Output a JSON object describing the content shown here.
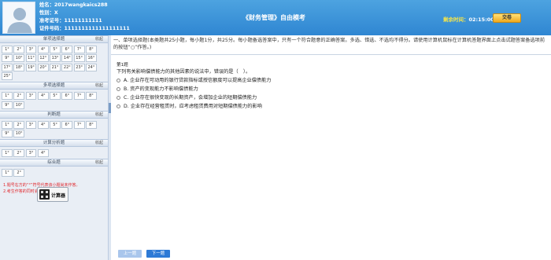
{
  "header": {
    "name": "姓名：2017wangkaics288",
    "gender": "性别：X",
    "admission": "准考证号：11111111111",
    "id_number": "证件号码：1111111111111111111",
    "title": "《财务管理》自由模考",
    "timer_label": "剩余时间：",
    "timer_value": "02:15:00",
    "submit_label": "交卷"
  },
  "sidebar": {
    "sections": [
      {
        "title": "单项选择题",
        "collapse": "收起",
        "items": [
          "1°",
          "2°",
          "3°",
          "4°",
          "5°",
          "6°",
          "7°",
          "8°",
          "9°",
          "10°",
          "11°",
          "12°",
          "13°",
          "14°",
          "15°",
          "16°",
          "17°",
          "18°",
          "19°",
          "20°",
          "21°",
          "22°",
          "23°",
          "24°",
          "25°"
        ]
      },
      {
        "title": "多项选择题",
        "collapse": "收起",
        "items": [
          "1°",
          "2°",
          "3°",
          "4°",
          "5°",
          "6°",
          "7°",
          "8°",
          "9°",
          "10°"
        ]
      },
      {
        "title": "判断题",
        "collapse": "收起",
        "items": [
          "1°",
          "2°",
          "3°",
          "4°",
          "5°",
          "6°",
          "7°",
          "8°",
          "9°",
          "10°"
        ]
      },
      {
        "title": "计算分析题",
        "collapse": "收起",
        "items": [
          "1°",
          "2°",
          "3°",
          "4°"
        ]
      },
      {
        "title": "综合题",
        "collapse": "收起",
        "items": [
          "1°",
          "2°"
        ]
      }
    ],
    "notes": [
      "1.题号右方的“°”符号代表该小题尚未作答。",
      "2.考生作答的同时会自动保存答案。"
    ],
    "calculator_label": "计算器"
  },
  "main": {
    "instruction": "一、单项选择题(本类题共25小题，每小题1分，共25分。每小题备选答案中，只有一个符合题意的正确答案。多选、错选、不选均不得分。请使用计算机鼠标在计算机答题界面上点击试题答案备选项前的按钮“○”作答。)",
    "question_number": "第1题",
    "question_text": "下列有关影响偿债能力的其他因素的说法中，错误的是（　）。",
    "options": [
      "A. 企业存在可动用的银行贷款指标或授信额度可以提高企业偿债能力",
      "B. 资产的变现能力不影响偿债能力",
      "C. 企业存在很快变现的长期资产，会增加企业的短期偿债能力",
      "D. 企业存在经营租赁时，应考虑租赁费用对短期偿债能力的影响"
    ],
    "prev_label": "上一题",
    "next_label": "下一题"
  },
  "colors": {
    "header": "#2f86d2",
    "accent": "#2d7ad6",
    "notes": "#e0262b",
    "timer_label": "#f6e64a"
  }
}
